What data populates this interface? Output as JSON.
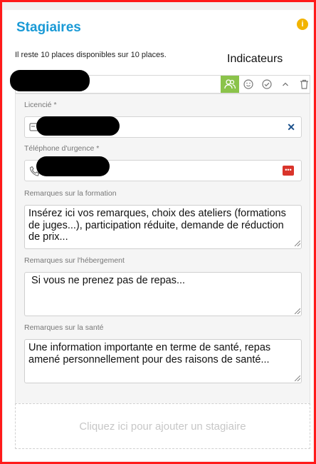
{
  "header": {
    "title": "Stagiaires",
    "info_icon": "i"
  },
  "places_text": "Il reste 10 places disponibles sur 10 places.",
  "indicators_label": "Indicateurs",
  "toolbar": {
    "buttons": [
      "users-icon",
      "smiley-icon",
      "check-circle-icon",
      "chevron-up-icon",
      "trash-icon"
    ],
    "active_color": "#8bc34a"
  },
  "form": {
    "licence_label": "Licencié *",
    "phone_label": "Téléphone d'urgence *",
    "formation_label": "Remarques sur la formation",
    "formation_value": "Insérez ici vos remarques, choix des ateliers (formations de juges...), participation réduite, demande de réduction de prix...",
    "hebergement_label": "Remarques sur l'hébergement",
    "hebergement_value": " Si vous ne prenez pas de repas...",
    "sante_label": "Remarques sur la santé",
    "sante_value": "Une information importante en terme de santé, repas amené personnellement pour des raisons de santé..."
  },
  "add_trainee": "Cliquez ici pour ajouter un stagiaire",
  "colors": {
    "title": "#1a9ad6",
    "annotation_border": "#ff1a1a"
  }
}
